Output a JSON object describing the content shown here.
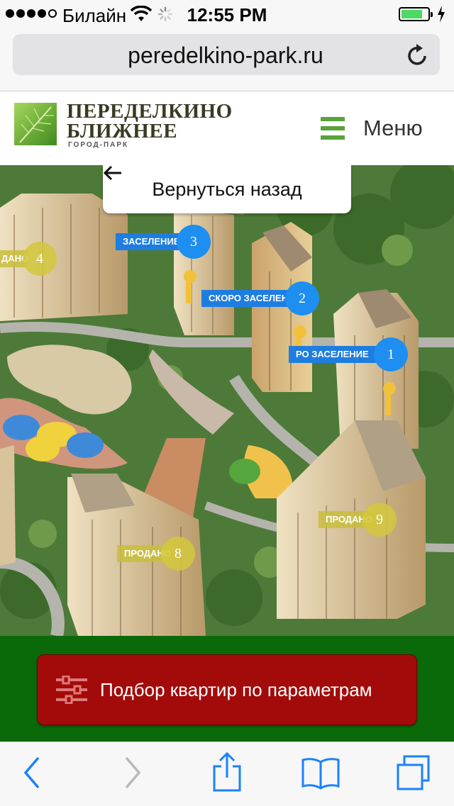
{
  "status_bar": {
    "carrier": "Билайн",
    "time": "12:55 PM",
    "signal_bars_filled": 4,
    "signal_bars_total": 5,
    "battery_level": 0.8
  },
  "browser": {
    "url": "peredelkino-park.ru"
  },
  "header": {
    "logo_line1": "ПЕРЕДЕЛКИНО",
    "logo_line2": "БЛИЖНЕЕ",
    "logo_tagline": "ГОРОД-ПАРК",
    "menu_label": "Меню"
  },
  "map": {
    "back_label": "Вернуться назад",
    "buildings": [
      {
        "number": "1",
        "status": "СКОРО ЗАСЕЛЕНИЕ",
        "status_visible": "РО ЗАСЕЛЕНИЕ"
      },
      {
        "number": "2",
        "status": "СКОРО ЗАСЕЛЕНИЕ",
        "status_visible": "СКОРО ЗАСЕЛЕНИЕ"
      },
      {
        "number": "3",
        "status": "ЗАСЕЛЕНИЕ",
        "status_visible": "ЗАСЕЛЕНИЕ"
      },
      {
        "number": "4",
        "status": "ПРОДАНО",
        "status_visible": "ДАНО"
      },
      {
        "number": "8",
        "status": "ПРОДАНО",
        "status_visible": "ПРОДАНО"
      },
      {
        "number": "9",
        "status": "ПРОДАНО",
        "status_visible": "ПРОДАНО"
      }
    ]
  },
  "cta": {
    "filter_label": "Подбор квартир по параметрам"
  },
  "colors": {
    "accent_green": "#5aa23a",
    "band_green": "#0a6a0a",
    "cta_red": "#a30b0b",
    "pin_blue": "#1e8ff0",
    "ios_blue": "#1a82fb"
  }
}
